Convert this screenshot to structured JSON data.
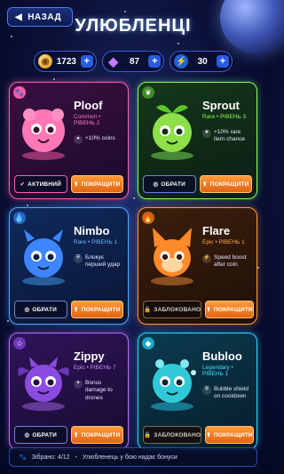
{
  "header": {
    "back_label": "НАЗАД",
    "title": "УЛЮБЛЕНЦІ"
  },
  "currency": {
    "coins": "1723",
    "gems": "87",
    "energy": "30"
  },
  "pets": [
    {
      "name": "Ploof",
      "rarity": "Common • РІВЕНЬ 2",
      "rarity_color": "#ff7db8",
      "perk": "+10% coins",
      "primary": "АКТИВНИЙ",
      "secondary": "ПОКРАЩИТИ",
      "color": "#ff6fb0"
    },
    {
      "name": "Sprout",
      "rarity": "Rare • РІВЕНЬ 3",
      "rarity_color": "#8cff5a",
      "perk": "+10% rare item chance",
      "primary": "ОБРАТИ",
      "secondary": "ПОКРАЩИТИ",
      "color": "#8ee04a"
    },
    {
      "name": "Nimbo",
      "rarity": "Rare • РІВЕНЬ 1",
      "rarity_color": "#6ab8ff",
      "perk": "Блокує перший удар",
      "primary": "ОБРАТИ",
      "secondary": "ПОКРАЩИТИ",
      "color": "#3d86ff"
    },
    {
      "name": "Flare",
      "rarity": "Epic • РІВЕНЬ 1",
      "rarity_color": "#ffa84c",
      "perk": "Speed boost after coin",
      "primary": "ЗАБЛОКОВАНО",
      "secondary": "ПОКРАЩИТИ",
      "color": "#ff8a2a"
    },
    {
      "name": "Zippy",
      "rarity": "Epic • РІВЕНЬ 7",
      "rarity_color": "#c68bff",
      "perk": "Bonus damage to drones",
      "primary": "ОБРАТИ",
      "secondary": "ПОКРАЩИТИ",
      "color": "#8a4be0"
    },
    {
      "name": "Bubloo",
      "rarity": "Legendary • РІВЕНЬ 1",
      "rarity_color": "#3fe0ff",
      "perk": "Bubble shield on cooldown",
      "primary": "ЗАБЛОКОВАНО",
      "secondary": "ПОКРАЩИТИ",
      "color": "#2fc9d8"
    }
  ],
  "footer": {
    "collected": "Зібрано: 4/12",
    "hint": "Улюбленець у бою надає бонуси"
  },
  "icons": {
    "back": "chevron-left-icon",
    "coin": "coin-icon",
    "gem": "gem-icon",
    "energy": "lightning-icon",
    "paw": "paw-icon"
  }
}
